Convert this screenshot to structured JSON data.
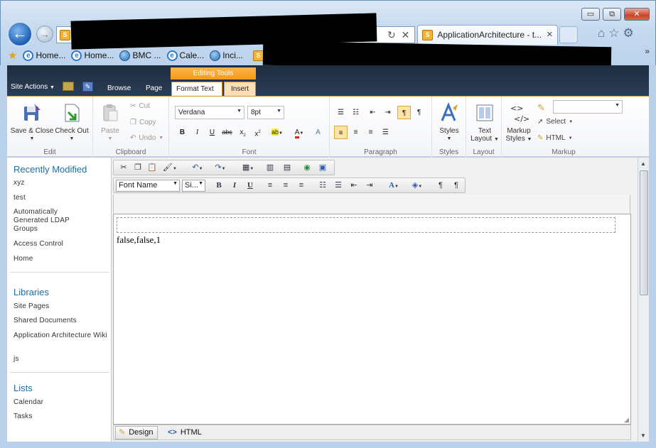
{
  "browser": {
    "active_tab_title": "ApplicationArchitecture - t...",
    "window_buttons": [
      "▭",
      "⧉",
      "✕"
    ],
    "fav_link_4": "Cale...",
    "favorites": [
      {
        "label": "Home...",
        "icon": "ie-page-icon"
      },
      {
        "label": "Home...",
        "icon": "ie-page-icon"
      },
      {
        "label": "BMC ...",
        "icon": "globe-icon"
      },
      {
        "label": "Cale...",
        "icon": "ie-page-icon"
      },
      {
        "label": "Inci...",
        "icon": "globe-icon"
      }
    ],
    "more": "»"
  },
  "ribbon": {
    "site_actions": "Site Actions",
    "tabs": [
      "Browse",
      "Page"
    ],
    "contextual_group": "Editing Tools",
    "contextual_tabs": [
      "Format Text",
      "Insert"
    ],
    "groups": {
      "edit": {
        "label": "Edit",
        "save": "Save & Close",
        "checkout": "Check Out"
      },
      "clipboard": {
        "label": "Clipboard",
        "paste": "Paste",
        "cut": "Cut",
        "copy": "Copy",
        "undo": "Undo"
      },
      "font": {
        "label": "Font",
        "family": "Verdana",
        "size": "8pt"
      },
      "paragraph": {
        "label": "Paragraph"
      },
      "styles": {
        "label": "Styles",
        "button": "Styles"
      },
      "layout": {
        "label": "Layout",
        "button_l1": "Text",
        "button_l2": "Layout"
      },
      "markup": {
        "label": "Markup",
        "styles_l1": "Markup",
        "styles_l2": "Styles",
        "select": "Select",
        "html": "HTML"
      }
    }
  },
  "leftnav": {
    "recently_modified": "Recently Modified",
    "recent_items": [
      "xyz",
      "test",
      "Automatically Generated LDAP Groups",
      "Access Control",
      "Home"
    ],
    "libraries": "Libraries",
    "library_items": [
      "Site Pages",
      "Shared Documents",
      "Application Architecture Wiki",
      "js"
    ],
    "lists": "Lists",
    "list_items": [
      "Calendar",
      "Tasks"
    ]
  },
  "editor": {
    "font_name": "Font Name",
    "size": "Si...",
    "content": "false,false,1",
    "modes": [
      "Design",
      "HTML"
    ]
  }
}
